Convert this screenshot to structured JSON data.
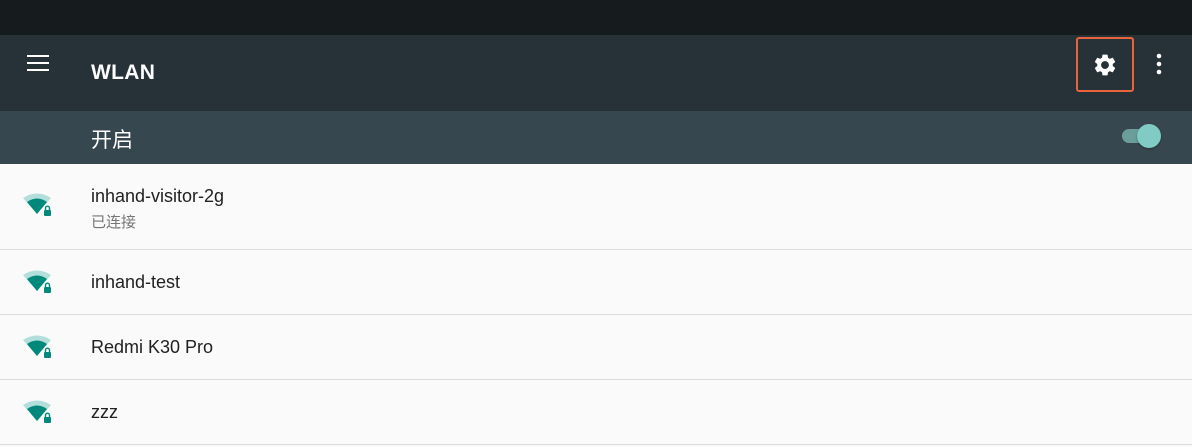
{
  "app": {
    "title": "WLAN"
  },
  "toolbar": {
    "menu_icon": "hamburger-menu-icon",
    "settings_icon": "gear-icon",
    "more_icon": "more-vert-icon",
    "highlight_color": "#e8643a"
  },
  "master_switch": {
    "label": "开启",
    "state": "on"
  },
  "networks": [
    {
      "ssid": "inhand-visitor-2g",
      "status": "已连接",
      "secured": true,
      "icon": "wifi-lock-icon"
    },
    {
      "ssid": "inhand-test",
      "status": "",
      "secured": true,
      "icon": "wifi-lock-icon"
    },
    {
      "ssid": "Redmi K30 Pro",
      "status": "",
      "secured": true,
      "icon": "wifi-lock-icon"
    },
    {
      "ssid": "zzz",
      "status": "",
      "secured": true,
      "icon": "wifi-lock-icon"
    }
  ],
  "colors": {
    "status_bar": "#161b1e",
    "app_bar": "#263238",
    "switch_bar": "#37474f",
    "accent": "#80cbc4",
    "wifi_icon": "#00897b"
  }
}
